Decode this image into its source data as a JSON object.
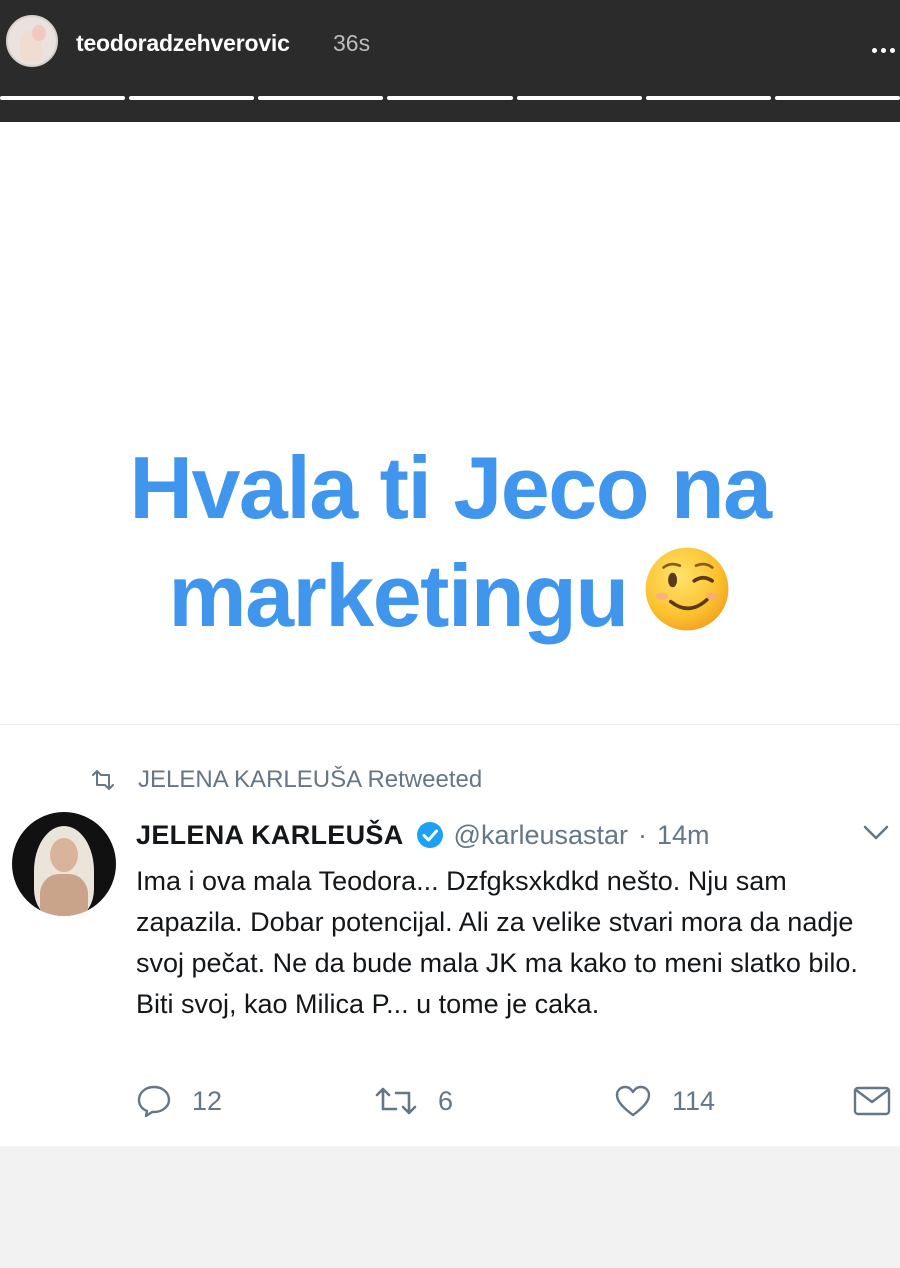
{
  "story": {
    "username": "teodoradzehverovic",
    "time": "36s",
    "progress_segments": 7
  },
  "caption": {
    "line1": "Hvala ti Jeco na",
    "line2": "marketingu"
  },
  "tweet": {
    "retweet_label": "JELENA KARLEUŠA Retweeted",
    "display_name": "JELENA KARLEUŠA",
    "handle": "@karleusastar",
    "separator": "·",
    "time": "14m",
    "text": "Ima i ova mala Teodora... Dzfgksxkdkd nešto. Nju sam zapazila. Dobar potencijal. Ali za velike stvari mora da nadje svoj pečat. Ne da bude mala JK ma kako to meni slatko bilo. Biti svoj, kao Milica P... u tome je caka.",
    "actions": {
      "replies": "12",
      "retweets": "6",
      "likes": "114"
    }
  },
  "colors": {
    "caption": "#3f96ec",
    "twitter_blue": "#1da1f2",
    "muted": "#657786",
    "header_bg": "#2b2b2b"
  },
  "icons": [
    "more-icon",
    "retweet-icon",
    "verified-icon",
    "chevron-down-icon",
    "reply-icon",
    "like-icon",
    "dm-icon",
    "wink-emoji"
  ]
}
